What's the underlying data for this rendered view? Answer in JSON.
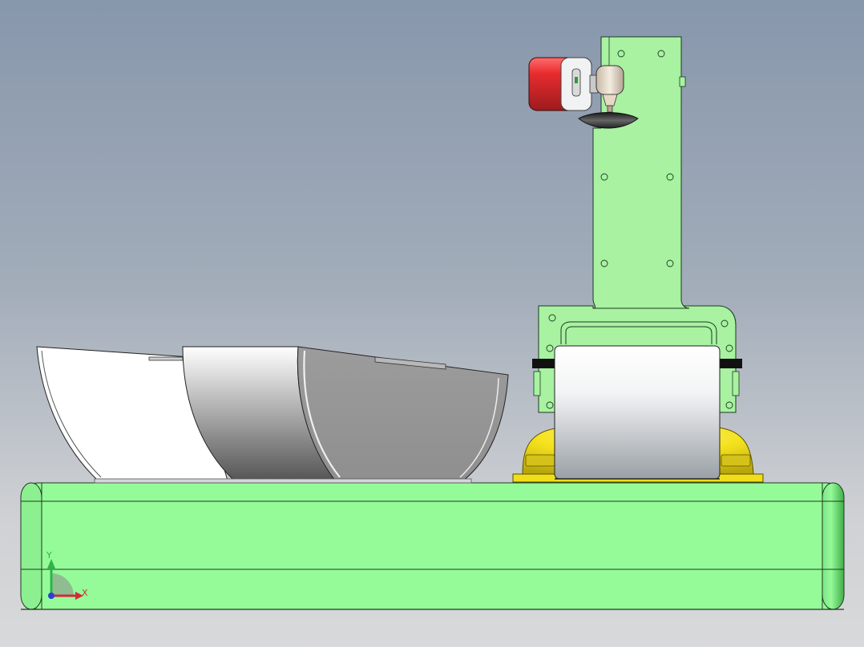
{
  "axis_triad": {
    "x_label": "X",
    "y_label": "Y",
    "x_color": "#d6283a",
    "y_color": "#2fb34a",
    "z_color": "#2b3fd6"
  },
  "colors": {
    "background_top": "#8797ac",
    "background_bottom": "#d8d9da",
    "base_green": "#95fb99",
    "frame_green": "#a8f2a2",
    "motor_red": "#d9262b",
    "dome_yellow": "#f2e21a",
    "cylinder_gray": "#d7d9db"
  },
  "parts": [
    "base-plate",
    "bowl-white",
    "bowl-gradient",
    "bowl-dark",
    "vertical-arm",
    "motor",
    "spray-nozzle",
    "roller-drum",
    "yellow-dome",
    "mount-bracket"
  ]
}
